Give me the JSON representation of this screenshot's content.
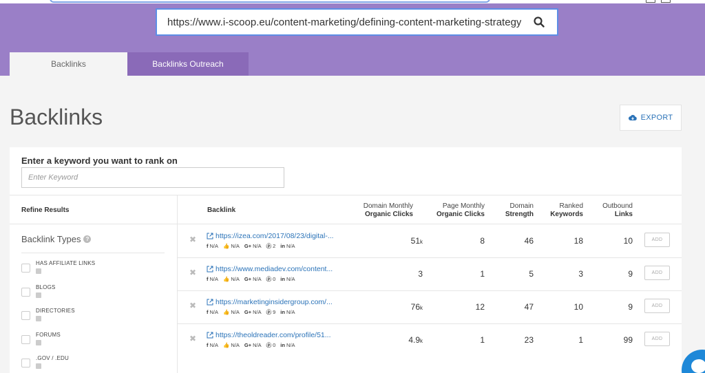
{
  "search": {
    "url": "https://www.i-scoop.eu/content-marketing/defining-content-marketing-strategy/",
    "icon": "search-icon"
  },
  "tabs": [
    {
      "label": "Backlinks",
      "active": true
    },
    {
      "label": "Backlinks Outreach",
      "active": false
    }
  ],
  "page": {
    "title": "Backlinks",
    "export_label": "EXPORT"
  },
  "keyword": {
    "label": "Enter a keyword you want to rank on",
    "placeholder": "Enter Keyword"
  },
  "sidebar": {
    "refine_title": "Refine Results",
    "section_title": "Backlink Types",
    "filters": [
      {
        "label": "HAS AFFILIATE LINKS"
      },
      {
        "label": "BLOGS"
      },
      {
        "label": "DIRECTORIES"
      },
      {
        "label": "FORUMS"
      },
      {
        "label": ".GOV / .EDU"
      }
    ]
  },
  "table": {
    "headers": {
      "backlink": "Backlink",
      "domain_clicks_1": "Domain Monthly",
      "domain_clicks_2": "Organic Clicks",
      "page_clicks_1": "Page Monthly",
      "page_clicks_2": "Organic Clicks",
      "domain_strength_1": "Domain",
      "domain_strength_2": "Strength",
      "ranked_1": "Ranked",
      "ranked_2": "Keywords",
      "outbound_1": "Outbound",
      "outbound_2": "Links"
    },
    "add_label": "ADD",
    "rows": [
      {
        "url": "https://izea.com/2017/08/23/digital-...",
        "fb": "N/A",
        "like": "N/A",
        "gplus": "N/A",
        "pin": "2",
        "li": "N/A",
        "domain_clicks": "51",
        "domain_clicks_unit": "k",
        "page_clicks": "8",
        "strength": "46",
        "ranked": "18",
        "outbound": "10"
      },
      {
        "url": "https://www.mediadev.com/content...",
        "fb": "N/A",
        "like": "N/A",
        "gplus": "N/A",
        "pin": "0",
        "li": "N/A",
        "domain_clicks": "3",
        "domain_clicks_unit": "",
        "page_clicks": "1",
        "strength": "5",
        "ranked": "3",
        "outbound": "9"
      },
      {
        "url": "https://marketinginsidergroup.com/...",
        "fb": "N/A",
        "like": "N/A",
        "gplus": "N/A",
        "pin": "9",
        "li": "N/A",
        "domain_clicks": "76",
        "domain_clicks_unit": "k",
        "page_clicks": "12",
        "strength": "47",
        "ranked": "10",
        "outbound": "9"
      },
      {
        "url": "https://theoldreader.com/profile/51...",
        "fb": "N/A",
        "like": "N/A",
        "gplus": "N/A",
        "pin": "0",
        "li": "N/A",
        "domain_clicks": "4.9",
        "domain_clicks_unit": "k",
        "page_clicks": "1",
        "strength": "23",
        "ranked": "1",
        "outbound": "99"
      }
    ]
  },
  "social_labels": {
    "fb": "f",
    "gplus": "G+",
    "li": "in"
  },
  "colors": {
    "header": "#9a7fc7",
    "active_tab_dark": "#8a6ab8",
    "link": "#2b73b8",
    "chat": "#1e88d8"
  }
}
